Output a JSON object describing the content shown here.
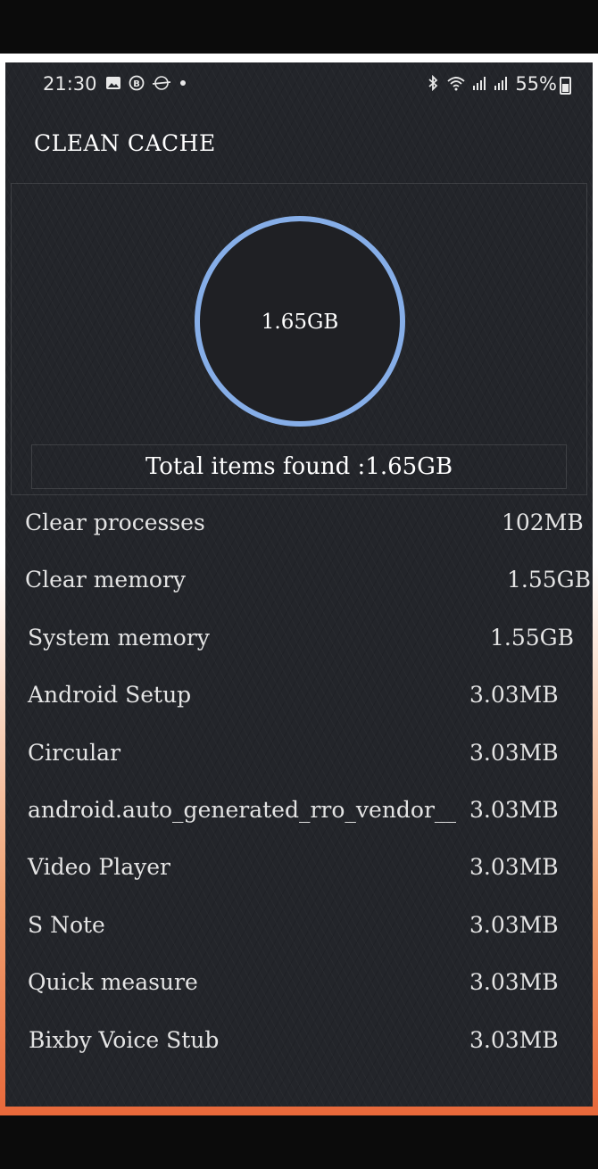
{
  "status_bar": {
    "time": "21:30",
    "battery": "55%",
    "left_icons": [
      "image-icon",
      "b-badge-icon",
      "flag-icon",
      "dot-icon"
    ],
    "right_icons": [
      "bluetooth-icon",
      "wifi-icon",
      "signal-icon",
      "signal-icon"
    ]
  },
  "page": {
    "title": "CLEAN CACHE"
  },
  "gauge": {
    "value": "1.65GB",
    "color": "#86aee8"
  },
  "summary": {
    "total": "Total items found :1.65GB"
  },
  "items": [
    {
      "name": "Clear processes",
      "size": "102MB"
    },
    {
      "name": "Clear memory",
      "size": "1.55GB"
    },
    {
      "name": "System memory",
      "size": "1.55GB"
    },
    {
      "name": "Android Setup",
      "size": "3.03MB"
    },
    {
      "name": "Circular",
      "size": "3.03MB"
    },
    {
      "name": "android.auto_generated_rro_vendor__",
      "size": "3.03MB"
    },
    {
      "name": "Video Player",
      "size": "3.03MB"
    },
    {
      "name": "S Note",
      "size": "3.03MB"
    },
    {
      "name": "Quick measure",
      "size": "3.03MB"
    },
    {
      "name": "Bixby Voice Stub",
      "size": "3.03MB"
    }
  ]
}
